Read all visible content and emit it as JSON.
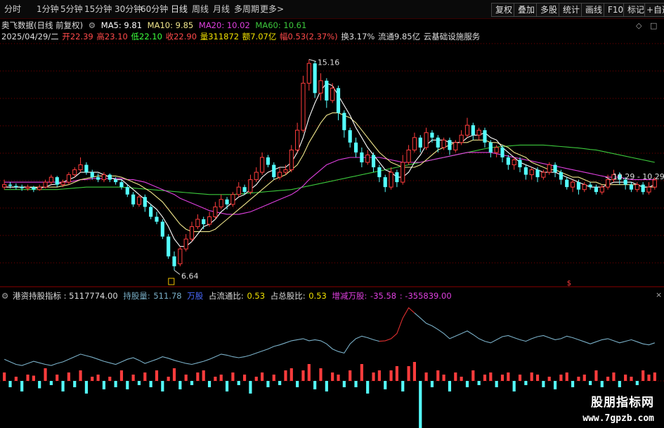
{
  "toolbar": {
    "periods": [
      "分时",
      "1分钟",
      "5分钟",
      "15分钟",
      "30分钟",
      "60分钟",
      "日线",
      "周线",
      "月线",
      "多周期",
      "更多>"
    ],
    "active_period": "日线",
    "buttons": [
      "复权",
      "叠加",
      "多股",
      "统计",
      "画线",
      "F10",
      "标记",
      "+自选"
    ]
  },
  "header": {
    "stock_name": "奥飞数据(日线 前复权)",
    "ma5": "MA5: 9.81",
    "ma10": "MA10: 9.85",
    "ma20": "MA20: 10.02",
    "ma60": "MA60: 10.61",
    "info": {
      "date": "2025/04/29/二",
      "open": "开22.39",
      "high": "高23.10",
      "low": "低22.10",
      "close": "收22.90",
      "volume": "量311872",
      "amount": "额7.07亿",
      "change": "幅0.53(2.37%)",
      "turnover": "换3.17%",
      "float": "流通9.85亿",
      "sector": "云基础设施服务"
    }
  },
  "indicator_header": {
    "name": "港资持股指标",
    "v1": ": 5117774.00",
    "v2_label": "持股量:",
    "v2": "511.78",
    "unit": "万股",
    "ratio1_label": "占流通比:",
    "ratio1": "0.53",
    "ratio2_label": "占总股比:",
    "ratio2": "0.53",
    "chg_label": "增减万股:",
    "chg": "-35.58",
    "chg2": ": -355839.00"
  },
  "annotations": {
    "high": "15.16",
    "low": "6.64",
    "last": "10.29 - 10.29"
  },
  "watermark": {
    "line1": "股朋指标网",
    "line2": "www.7gpzb.com"
  },
  "colors": {
    "up": "#ff3c3c",
    "down": "#54ffff",
    "ma5": "#ffffff",
    "ma10": "#f0e68c",
    "ma20": "#e040e0",
    "ma60": "#3cc83c",
    "holding": "#7ab0c8",
    "grid": "#7a0000"
  },
  "chart_data": {
    "type": "candlestick",
    "title": "奥飞数据(日线 前复权)",
    "ylim": [
      6.2,
      15.8
    ],
    "annotated_high": 15.16,
    "annotated_low": 6.64,
    "candles": [
      [
        10.0,
        10.1,
        10.3,
        9.9
      ],
      [
        10.1,
        10.05,
        10.2,
        9.95
      ],
      [
        10.05,
        10.0,
        10.15,
        9.9
      ],
      [
        10.0,
        9.95,
        10.1,
        9.85
      ],
      [
        9.95,
        10.0,
        10.1,
        9.85
      ],
      [
        10.0,
        9.9,
        10.05,
        9.8
      ],
      [
        9.9,
        10.0,
        10.1,
        9.85
      ],
      [
        10.0,
        10.2,
        10.3,
        9.95
      ],
      [
        10.2,
        10.4,
        10.5,
        10.1
      ],
      [
        10.4,
        10.1,
        10.45,
        10.0
      ],
      [
        10.1,
        10.2,
        10.3,
        10.0
      ],
      [
        10.2,
        10.5,
        10.6,
        10.1
      ],
      [
        10.5,
        10.7,
        10.8,
        10.4
      ],
      [
        10.7,
        10.9,
        11.2,
        10.6
      ],
      [
        10.9,
        10.6,
        11.0,
        10.5
      ],
      [
        10.6,
        10.4,
        10.7,
        10.3
      ],
      [
        10.4,
        10.3,
        10.55,
        10.2
      ],
      [
        10.3,
        10.5,
        10.6,
        10.2
      ],
      [
        10.5,
        10.3,
        10.55,
        10.2
      ],
      [
        10.3,
        10.2,
        10.4,
        10.1
      ],
      [
        10.2,
        10.0,
        10.3,
        9.9
      ],
      [
        10.0,
        9.7,
        10.1,
        9.6
      ],
      [
        9.7,
        9.3,
        9.8,
        9.2
      ],
      [
        9.3,
        9.6,
        9.7,
        9.2
      ],
      [
        9.6,
        9.2,
        9.7,
        9.0
      ],
      [
        9.2,
        8.8,
        9.3,
        8.7
      ],
      [
        8.8,
        8.6,
        9.0,
        8.5
      ],
      [
        8.6,
        8.0,
        8.7,
        7.9
      ],
      [
        8.0,
        7.2,
        8.1,
        7.1
      ],
      [
        7.2,
        6.8,
        7.4,
        6.64
      ],
      [
        6.9,
        7.5,
        7.6,
        6.8
      ],
      [
        7.5,
        7.9,
        8.1,
        7.4
      ],
      [
        7.9,
        8.4,
        8.6,
        7.8
      ],
      [
        8.4,
        8.7,
        8.9,
        8.3
      ],
      [
        8.7,
        8.5,
        8.8,
        8.3
      ],
      [
        8.5,
        8.8,
        9.0,
        8.4
      ],
      [
        8.8,
        9.2,
        9.4,
        8.7
      ],
      [
        9.2,
        9.5,
        9.7,
        9.1
      ],
      [
        9.5,
        9.3,
        9.6,
        9.1
      ],
      [
        9.3,
        9.7,
        9.8,
        9.2
      ],
      [
        9.7,
        10.0,
        10.2,
        9.6
      ],
      [
        10.0,
        9.8,
        10.1,
        9.7
      ],
      [
        9.8,
        10.3,
        10.5,
        9.7
      ],
      [
        10.3,
        10.6,
        10.8,
        10.2
      ],
      [
        10.6,
        11.2,
        11.4,
        10.5
      ],
      [
        11.2,
        10.9,
        11.3,
        10.8
      ],
      [
        10.9,
        10.4,
        11.0,
        10.3
      ],
      [
        10.4,
        10.6,
        10.8,
        10.3
      ],
      [
        10.6,
        10.7,
        10.9,
        10.5
      ],
      [
        10.7,
        11.5,
        11.7,
        10.6
      ],
      [
        11.5,
        12.3,
        12.6,
        11.4
      ],
      [
        12.3,
        14.2,
        14.5,
        12.2
      ],
      [
        14.2,
        15.0,
        15.16,
        13.9
      ],
      [
        15.0,
        13.8,
        15.1,
        13.6
      ],
      [
        13.8,
        14.3,
        14.6,
        13.5
      ],
      [
        14.3,
        13.5,
        14.4,
        13.2
      ],
      [
        13.5,
        14.0,
        14.2,
        13.4
      ],
      [
        14.0,
        13.0,
        14.1,
        12.7
      ],
      [
        13.0,
        12.3,
        13.1,
        12.0
      ],
      [
        12.3,
        11.8,
        12.4,
        11.6
      ],
      [
        11.8,
        11.4,
        12.0,
        11.2
      ],
      [
        11.4,
        11.0,
        11.6,
        10.8
      ],
      [
        11.0,
        11.3,
        11.5,
        10.9
      ],
      [
        11.3,
        10.8,
        11.4,
        10.6
      ],
      [
        10.8,
        10.4,
        10.9,
        10.2
      ],
      [
        10.4,
        10.0,
        10.5,
        9.8
      ],
      [
        10.0,
        10.6,
        10.8,
        9.9
      ],
      [
        10.6,
        10.2,
        10.7,
        10.0
      ],
      [
        10.2,
        11.0,
        11.3,
        10.1
      ],
      [
        11.0,
        11.5,
        11.7,
        10.9
      ],
      [
        11.5,
        12.0,
        12.2,
        11.4
      ],
      [
        12.0,
        11.6,
        12.1,
        11.4
      ],
      [
        11.6,
        12.2,
        12.4,
        11.5
      ],
      [
        12.2,
        12.0,
        12.3,
        11.8
      ],
      [
        12.0,
        11.6,
        12.1,
        11.4
      ],
      [
        11.6,
        11.9,
        12.0,
        11.5
      ],
      [
        11.9,
        11.5,
        12.0,
        11.3
      ],
      [
        11.5,
        11.8,
        11.9,
        11.4
      ],
      [
        11.8,
        12.1,
        12.3,
        11.7
      ],
      [
        12.1,
        12.5,
        12.8,
        12.0
      ],
      [
        12.5,
        12.1,
        12.6,
        11.9
      ],
      [
        12.1,
        12.3,
        12.4,
        11.9
      ],
      [
        12.3,
        11.8,
        12.4,
        11.6
      ],
      [
        11.8,
        11.4,
        11.9,
        11.2
      ],
      [
        11.4,
        11.6,
        11.7,
        11.2
      ],
      [
        11.6,
        11.2,
        11.7,
        11.0
      ],
      [
        11.2,
        10.9,
        11.3,
        10.7
      ],
      [
        10.9,
        11.1,
        11.2,
        10.7
      ],
      [
        11.1,
        10.8,
        11.2,
        10.6
      ],
      [
        10.8,
        10.5,
        10.9,
        10.3
      ],
      [
        10.5,
        10.7,
        10.8,
        10.3
      ],
      [
        10.7,
        10.4,
        10.8,
        10.2
      ],
      [
        10.4,
        10.6,
        10.7,
        10.3
      ],
      [
        10.6,
        10.9,
        11.0,
        10.5
      ],
      [
        10.9,
        10.6,
        11.0,
        10.4
      ],
      [
        10.6,
        10.3,
        10.7,
        10.1
      ],
      [
        10.3,
        10.0,
        10.4,
        9.9
      ],
      [
        10.0,
        10.2,
        10.3,
        9.8
      ],
      [
        10.2,
        9.9,
        10.3,
        9.7
      ],
      [
        9.9,
        10.1,
        10.2,
        9.8
      ],
      [
        10.1,
        10.0,
        10.2,
        9.9
      ],
      [
        10.0,
        9.8,
        10.1,
        9.7
      ],
      [
        9.8,
        10.0,
        10.1,
        9.7
      ],
      [
        10.0,
        10.3,
        10.5,
        9.9
      ],
      [
        10.3,
        10.5,
        10.7,
        10.2
      ],
      [
        10.5,
        10.3,
        10.6,
        10.1
      ],
      [
        10.3,
        10.1,
        10.4,
        9.9
      ],
      [
        10.1,
        9.9,
        10.2,
        9.8
      ],
      [
        9.9,
        10.1,
        10.2,
        9.8
      ],
      [
        10.1,
        9.8,
        10.2,
        9.7
      ],
      [
        9.8,
        10.0,
        10.2,
        9.7
      ],
      [
        10.0,
        10.29,
        10.4,
        9.9
      ]
    ],
    "ma5": [
      10.0,
      10.0,
      10.0,
      10.0,
      10.0,
      9.97,
      9.96,
      10.0,
      10.1,
      10.12,
      10.2,
      10.3,
      10.4,
      10.6,
      10.6,
      10.6,
      10.6,
      10.5,
      10.4,
      10.3,
      10.3,
      10.1,
      9.9,
      9.7,
      9.5,
      9.3,
      9.1,
      8.8,
      8.4,
      7.9,
      7.6,
      7.6,
      7.8,
      8.1,
      8.4,
      8.5,
      8.7,
      9.0,
      9.2,
      9.4,
      9.6,
      9.7,
      9.9,
      10.1,
      10.4,
      10.6,
      10.7,
      10.8,
      10.8,
      11.0,
      11.4,
      12.0,
      12.8,
      13.4,
      13.9,
      14.2,
      14.1,
      13.7,
      13.3,
      12.9,
      12.4,
      12.0,
      11.6,
      11.3,
      11.0,
      10.7,
      10.6,
      10.4,
      10.4,
      10.6,
      11.0,
      11.3,
      11.7,
      11.9,
      11.9,
      11.9,
      11.8,
      11.8,
      11.8,
      12.0,
      12.1,
      12.1,
      12.2,
      12.0,
      11.9,
      11.6,
      11.4,
      11.2,
      11.0,
      10.9,
      10.8,
      10.7,
      10.6,
      10.6,
      10.6,
      10.5,
      10.4,
      10.3,
      10.2,
      10.1,
      10.0,
      10.0,
      10.0,
      10.1,
      10.2,
      10.2,
      10.2,
      10.2,
      10.1,
      10.0,
      10.0,
      10.1
    ],
    "ma10": [
      10.0,
      10.0,
      10.0,
      10.0,
      10.0,
      10.0,
      10.0,
      10.0,
      10.0,
      10.0,
      10.05,
      10.1,
      10.2,
      10.3,
      10.35,
      10.4,
      10.45,
      10.45,
      10.45,
      10.45,
      10.4,
      10.3,
      10.2,
      10.1,
      9.95,
      9.8,
      9.6,
      9.4,
      9.1,
      8.8,
      8.5,
      8.3,
      8.2,
      8.2,
      8.2,
      8.2,
      8.3,
      8.5,
      8.7,
      8.9,
      9.1,
      9.3,
      9.5,
      9.7,
      9.9,
      10.1,
      10.3,
      10.4,
      10.5,
      10.7,
      10.9,
      11.3,
      11.8,
      12.2,
      12.6,
      12.9,
      13.0,
      13.0,
      12.9,
      12.8,
      12.6,
      12.3,
      12.0,
      11.7,
      11.4,
      11.2,
      11.0,
      10.9,
      10.8,
      10.8,
      10.8,
      10.9,
      11.1,
      11.3,
      11.5,
      11.6,
      11.7,
      11.8,
      11.8,
      11.8,
      11.9,
      11.9,
      11.9,
      11.8,
      11.8,
      11.7,
      11.6,
      11.4,
      11.3,
      11.2,
      11.0,
      10.9,
      10.8,
      10.7,
      10.7,
      10.6,
      10.5,
      10.4,
      10.4,
      10.3,
      10.2,
      10.2,
      10.1,
      10.1,
      10.1,
      10.1,
      10.1,
      10.1,
      10.1,
      10.0,
      10.0,
      10.0
    ],
    "ma20": [
      10.2,
      10.2,
      10.2,
      10.2,
      10.2,
      10.2,
      10.2,
      10.2,
      10.2,
      10.2,
      10.2,
      10.2,
      10.25,
      10.3,
      10.3,
      10.35,
      10.35,
      10.35,
      10.35,
      10.35,
      10.35,
      10.3,
      10.3,
      10.25,
      10.2,
      10.1,
      10.0,
      9.9,
      9.8,
      9.7,
      9.55,
      9.45,
      9.35,
      9.25,
      9.15,
      9.05,
      9.0,
      8.95,
      8.9,
      8.9,
      8.9,
      8.95,
      9.0,
      9.1,
      9.2,
      9.3,
      9.4,
      9.5,
      9.6,
      9.7,
      9.85,
      10.05,
      10.3,
      10.5,
      10.7,
      10.9,
      11.0,
      11.1,
      11.15,
      11.2,
      11.2,
      11.2,
      11.2,
      11.2,
      11.2,
      11.15,
      11.1,
      11.05,
      11.0,
      11.0,
      11.0,
      11.0,
      11.05,
      11.1,
      11.15,
      11.2,
      11.25,
      11.3,
      11.35,
      11.4,
      11.4,
      11.4,
      11.4,
      11.4,
      11.35,
      11.3,
      11.25,
      11.2,
      11.15,
      11.1,
      11.05,
      11.0,
      10.95,
      10.9,
      10.85,
      10.8,
      10.75,
      10.7,
      10.65,
      10.6,
      10.55,
      10.5,
      10.45,
      10.4,
      10.4,
      10.4,
      10.35,
      10.3,
      10.3,
      10.3,
      10.3,
      10.3
    ],
    "ma60": [
      9.9,
      9.9,
      9.9,
      9.9,
      9.9,
      9.9,
      9.9,
      9.9,
      9.9,
      9.9,
      9.92,
      9.94,
      9.96,
      9.98,
      10.0,
      10.0,
      10.0,
      10.0,
      10.0,
      10.0,
      10.0,
      9.98,
      9.96,
      9.94,
      9.92,
      9.9,
      9.88,
      9.86,
      9.84,
      9.82,
      9.8,
      9.78,
      9.76,
      9.74,
      9.72,
      9.7,
      9.7,
      9.7,
      9.7,
      9.7,
      9.72,
      9.74,
      9.76,
      9.78,
      9.8,
      9.82,
      9.84,
      9.86,
      9.88,
      9.9,
      9.95,
      10.0,
      10.05,
      10.1,
      10.15,
      10.2,
      10.25,
      10.3,
      10.35,
      10.4,
      10.45,
      10.5,
      10.55,
      10.6,
      10.65,
      10.7,
      10.75,
      10.8,
      10.85,
      10.9,
      10.95,
      11.0,
      11.05,
      11.1,
      11.15,
      11.2,
      11.25,
      11.3,
      11.35,
      11.4,
      11.45,
      11.5,
      11.55,
      11.6,
      11.62,
      11.64,
      11.66,
      11.68,
      11.7,
      11.7,
      11.7,
      11.7,
      11.7,
      11.68,
      11.66,
      11.64,
      11.62,
      11.6,
      11.58,
      11.55,
      11.52,
      11.5,
      11.45,
      11.4,
      11.35,
      11.3,
      11.25,
      11.2,
      11.15,
      11.1,
      11.05,
      11.0
    ],
    "holding": [
      560,
      555,
      550,
      548,
      552,
      556,
      553,
      550,
      548,
      552,
      555,
      560,
      565,
      570,
      567,
      564,
      560,
      556,
      553,
      550,
      555,
      560,
      563,
      558,
      552,
      556,
      560,
      565,
      562,
      558,
      555,
      552,
      550,
      553,
      556,
      560,
      565,
      570,
      568,
      565,
      563,
      565,
      568,
      572,
      576,
      580,
      585,
      588,
      592,
      596,
      598,
      600,
      596,
      598,
      596,
      590,
      580,
      575,
      572,
      590,
      600,
      605,
      602,
      598,
      595,
      596,
      600,
      610,
      640,
      660,
      650,
      640,
      630,
      625,
      618,
      610,
      600,
      605,
      610,
      615,
      608,
      600,
      595,
      592,
      598,
      604,
      606,
      602,
      598,
      595,
      600,
      604,
      606,
      602,
      598,
      600,
      605,
      602,
      598,
      594,
      590,
      594,
      598,
      600,
      596,
      592,
      595,
      598,
      594,
      590,
      588,
      592
    ],
    "holding_red_segments": [
      [
        64,
        70
      ]
    ],
    "volume_bars": [
      0.4,
      -0.3,
      0.2,
      -0.5,
      0.3,
      0.25,
      -0.35,
      0.6,
      -0.2,
      0.3,
      -0.5,
      0.4,
      -0.3,
      0.5,
      -0.6,
      0.2,
      0.3,
      -0.4,
      0.2,
      -0.3,
      0.5,
      -0.4,
      0.3,
      -0.2,
      0.4,
      -0.3,
      0.5,
      -0.5,
      0.2,
      0.6,
      -0.4,
      0.3,
      -0.2,
      0.4,
      0.5,
      -0.3,
      0.2,
      0.3,
      -0.5,
      0.4,
      -0.2,
      0.3,
      -0.6,
      0.2,
      0.4,
      -0.3,
      0.3,
      -0.2,
      0.5,
      0.6,
      -0.3,
      0.5,
      0.8,
      -0.4,
      0.6,
      -0.5,
      0.4,
      0.3,
      -0.3,
      0.5,
      -0.3,
      0.8,
      -0.6,
      0.4,
      0.5,
      -0.4,
      0.5,
      0.7,
      -0.5,
      0.7,
      0.9,
      -2.5,
      0.4,
      -0.3,
      0.5,
      0.3,
      -0.5,
      0.4,
      0.2,
      -0.3,
      0.5,
      -0.2,
      0.3,
      0.4,
      -0.3,
      0.3,
      0.4,
      -0.5,
      0.3,
      -0.2,
      0.4,
      0.3,
      -0.3,
      0.2,
      -0.4,
      0.3,
      0.4,
      -0.3,
      0.2,
      0.3,
      -0.2,
      0.5,
      -0.3,
      0.2,
      0.4,
      -0.3,
      0.3,
      0.2,
      -0.2,
      0.5,
      0.3,
      0.4
    ]
  }
}
